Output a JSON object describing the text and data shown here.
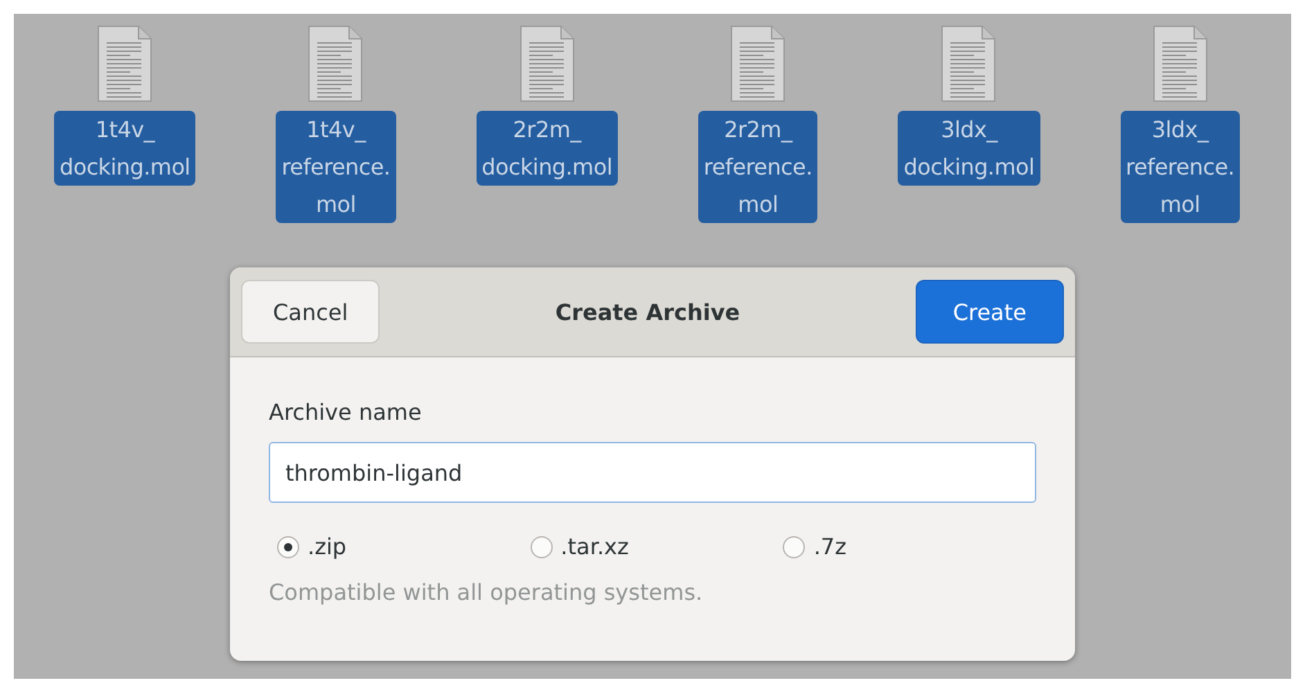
{
  "files": [
    {
      "label_lines": [
        "1t4v_",
        "docking.mol"
      ],
      "selected": true
    },
    {
      "label_lines": [
        "1t4v_",
        "reference.",
        "mol"
      ],
      "selected": true
    },
    {
      "label_lines": [
        "2r2m_",
        "docking.mol"
      ],
      "selected": true
    },
    {
      "label_lines": [
        "2r2m_",
        "reference.",
        "mol"
      ],
      "selected": true
    },
    {
      "label_lines": [
        "3ldx_",
        "docking.mol"
      ],
      "selected": true
    },
    {
      "label_lines": [
        "3ldx_",
        "reference.",
        "mol"
      ],
      "selected": true
    }
  ],
  "dialog": {
    "title": "Create Archive",
    "cancel_button": "Cancel",
    "create_button": "Create",
    "name_label": "Archive name",
    "name_value": "thrombin-ligand",
    "formats": [
      {
        "label": ".zip",
        "selected": true
      },
      {
        "label": ".tar.xz",
        "selected": false
      },
      {
        "label": ".7z",
        "selected": false
      }
    ],
    "hint": "Compatible with all operating systems."
  }
}
